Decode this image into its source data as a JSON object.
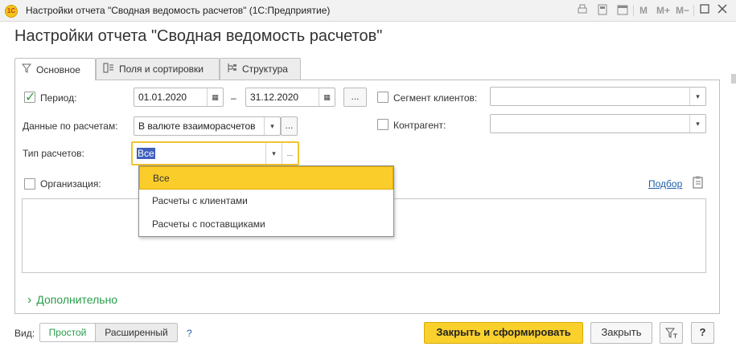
{
  "window": {
    "logo": "1С",
    "title": "Настройки отчета \"Сводная ведомость расчетов\"  (1С:Предприятие)",
    "toolbar": [
      "M",
      "M+",
      "M−"
    ]
  },
  "heading": "Настройки отчета \"Сводная ведомость расчетов\"",
  "tabs": [
    {
      "label": "Основное",
      "icon": "filter-icon"
    },
    {
      "label": "Поля и сортировки",
      "icon": "fields-icon"
    },
    {
      "label": "Структура",
      "icon": "structure-icon"
    }
  ],
  "form": {
    "period_label": "Период:",
    "period_checked": true,
    "date_from": "01.01.2020",
    "date_sep": "–",
    "date_to": "31.12.2020",
    "dots": "...",
    "data_label": "Данные по расчетам:",
    "data_value": "В валюте взаиморасчетов",
    "type_label": "Тип расчетов:",
    "type_value": "Все",
    "segment_label": "Сегмент клиентов:",
    "segment_value": "",
    "contractor_label": "Контрагент:",
    "contractor_value": "",
    "org_label": "Организация:",
    "podbor": "Подбор",
    "extra": "Дополнительно",
    "extra_arrow": "›"
  },
  "dropdown": {
    "items": [
      "Все",
      "Расчеты с клиентами",
      "Расчеты с поставщиками"
    ],
    "selected_index": 0
  },
  "bottom": {
    "view_label": "Вид:",
    "view_simple": "Простой",
    "view_extended": "Расширенный",
    "help_q": "?",
    "primary": "Закрыть и сформировать",
    "close": "Закрыть",
    "help": "?"
  },
  "colors": {
    "accent_yellow": "#fad02c",
    "green": "#2a9d4a",
    "link": "#1f5fa8"
  }
}
